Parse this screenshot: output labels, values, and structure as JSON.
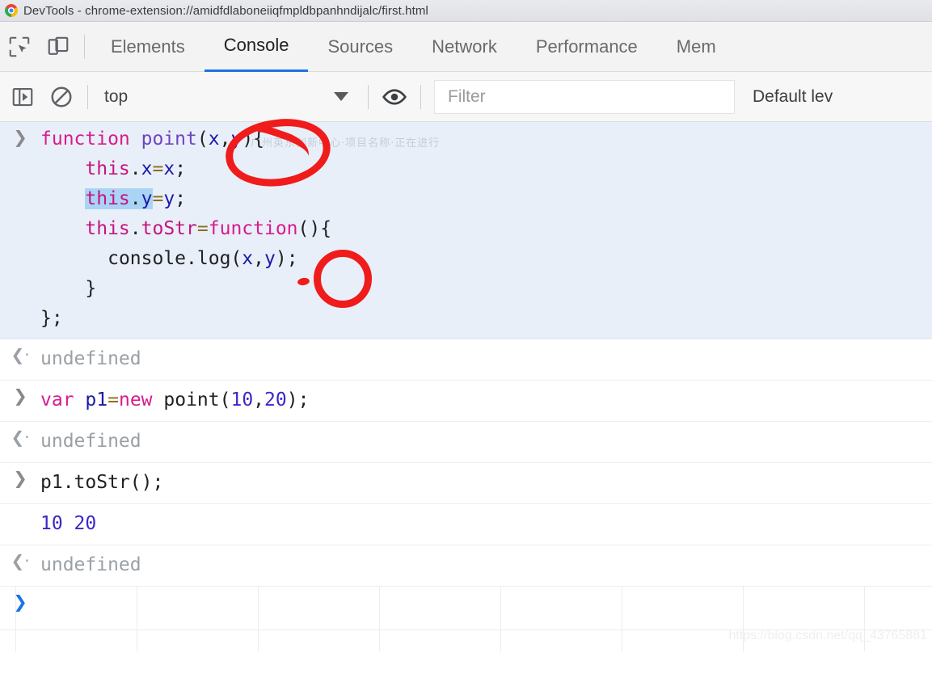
{
  "window": {
    "title": "DevTools - chrome-extension://amidfdlaboneiiqfmpldbpanhndijalc/first.html",
    "logo_icon": "chrome-logo-icon"
  },
  "tabstrip": {
    "inspect_icon": "inspect-element-icon",
    "device_icon": "device-toolbar-icon",
    "tabs": [
      {
        "label": "Elements",
        "active": false
      },
      {
        "label": "Console",
        "active": true
      },
      {
        "label": "Sources",
        "active": false
      },
      {
        "label": "Network",
        "active": false
      },
      {
        "label": "Performance",
        "active": false
      },
      {
        "label": "Mem",
        "active": false
      }
    ],
    "active_underline_color": "#1a73e8"
  },
  "console_toolbar": {
    "sidebar_toggle_icon": "console-sidebar-toggle-icon",
    "clear_icon": "clear-console-icon",
    "context": "top",
    "context_caret_icon": "chevron-down-icon",
    "eye_icon": "live-expression-eye-icon",
    "filter_placeholder": "Filter",
    "filter_value": "",
    "levels_label": "Default lev"
  },
  "console": {
    "entries": [
      {
        "kind": "input-multiline",
        "marker": "chevron-right",
        "lines": [
          "function point(x,y){",
          "    this.x=x;",
          "    this.y=y;",
          "    this.toStr=function(){",
          "      console.log(x,y);",
          "    }",
          "};"
        ]
      },
      {
        "kind": "result",
        "marker": "chevron-left",
        "text": "undefined"
      },
      {
        "kind": "input",
        "marker": "chevron-right",
        "text": "var p1=new point(10,20);"
      },
      {
        "kind": "result",
        "marker": "chevron-left",
        "text": "undefined"
      },
      {
        "kind": "input",
        "marker": "chevron-right",
        "text": "p1.toStr();"
      },
      {
        "kind": "log",
        "marker": "",
        "text": "10 20"
      },
      {
        "kind": "result",
        "marker": "chevron-left",
        "text": "undefined"
      },
      {
        "kind": "prompt",
        "marker": "chevron-right",
        "text": ""
      }
    ]
  },
  "annotations": {
    "circle_1_target": "(x,y)",
    "circle_2_target": "y",
    "color": "#f01b1b"
  },
  "watermarks": {
    "inline": "广州英东创新中心·项目名称·正在进行",
    "corner": "https://blog.csdn.net/qq_43765881"
  }
}
